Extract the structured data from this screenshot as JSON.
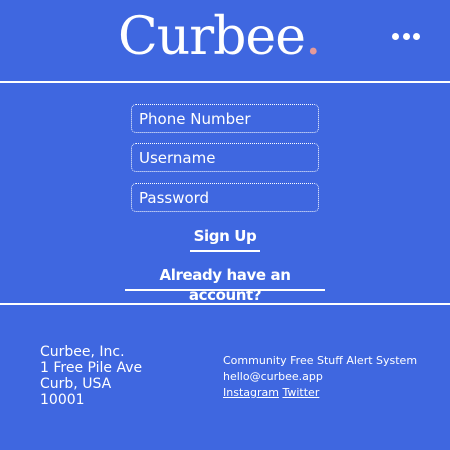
{
  "header": {
    "brand": "Curbee",
    "brand_dot": ".",
    "menu_icon": "more-horizontal-icon"
  },
  "form": {
    "phone_placeholder": "Phone Number",
    "username_placeholder": "Username",
    "password_placeholder": "Password",
    "signup_label": "Sign Up",
    "login_link_label": "Already have an account?"
  },
  "footer": {
    "address": {
      "company": "Curbee, Inc.",
      "street": "1 Free Pile Ave",
      "city": "Curb, USA",
      "zip": "10001"
    },
    "tagline": "Community Free Stuff Alert System",
    "email": "hello@curbee.app",
    "links": {
      "instagram": "Instagram",
      "twitter": "Twitter"
    }
  },
  "colors": {
    "background": "#3f67e0",
    "text": "#ffffff",
    "brand_dot": "#e59a9a"
  }
}
